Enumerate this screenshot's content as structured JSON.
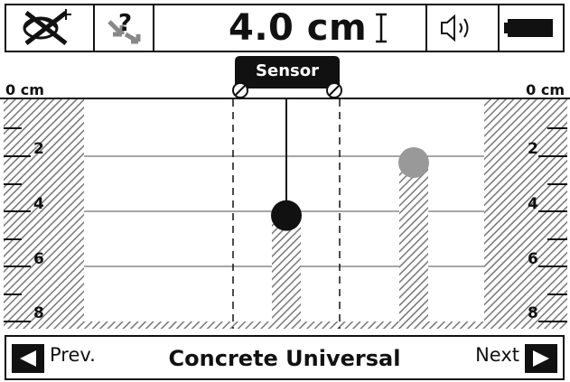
{
  "status_bar": {
    "icons": [
      "battery-x-icon",
      "question-arrow-icon",
      "speaker-icon",
      "battery-icon"
    ],
    "depth_value": "4.0 cm",
    "depth_icon": "depth-marker-icon"
  },
  "scan": {
    "sensor_label": "Sensor",
    "left_top_label": "0 cm",
    "right_top_label": "0 cm",
    "depth_scale": [
      "2",
      "4",
      "6",
      "8"
    ],
    "objects": [
      {
        "name": "metal-object",
        "color": "#111111",
        "depth_cm": 4.2
      },
      {
        "name": "non-metal-object",
        "color": "#999999",
        "depth_cm": 2.3
      }
    ]
  },
  "bottom_bar": {
    "prev_label": "Prev.",
    "mode_label": "Concrete Universal",
    "next_label": "Next"
  }
}
